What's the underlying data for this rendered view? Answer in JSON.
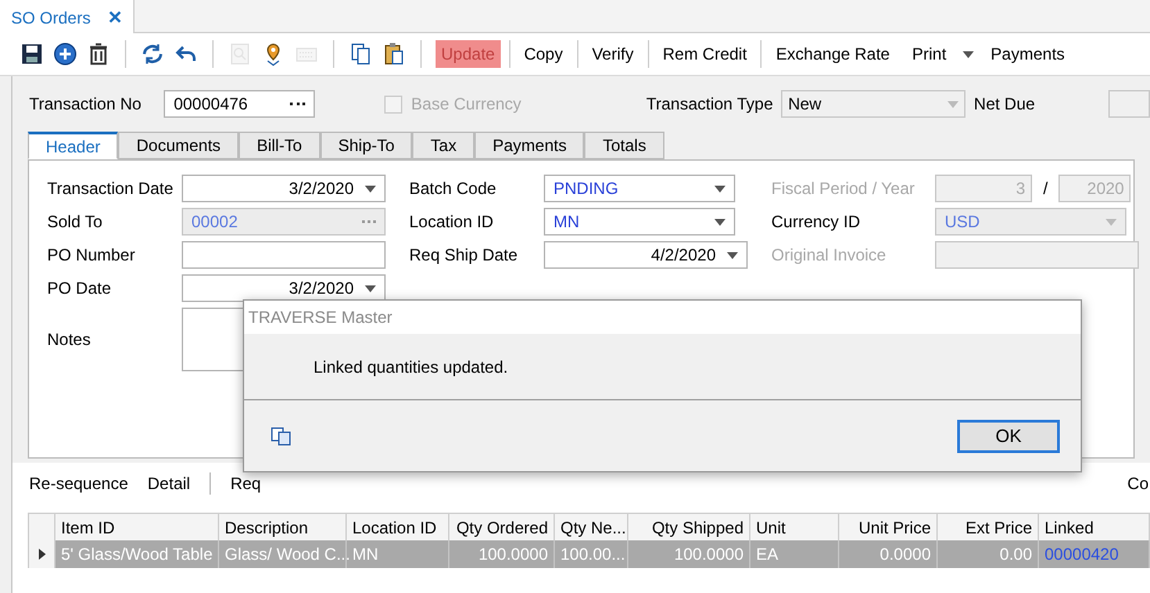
{
  "doc_tab": {
    "title": "SO Orders",
    "close": "✕",
    "selected": true
  },
  "toolbar": {
    "icons": [
      {
        "kind": "save",
        "disabled": false
      },
      {
        "kind": "add",
        "disabled": false
      },
      {
        "kind": "delete",
        "disabled": false
      },
      {
        "kind": "sep"
      },
      {
        "kind": "refresh",
        "disabled": false
      },
      {
        "kind": "undo",
        "disabled": false
      },
      {
        "kind": "sep"
      },
      {
        "kind": "search",
        "disabled": true
      },
      {
        "kind": "pin",
        "disabled": false
      },
      {
        "kind": "keyboard",
        "disabled": true
      },
      {
        "kind": "sep"
      },
      {
        "kind": "copy",
        "disabled": false
      },
      {
        "kind": "paste",
        "disabled": false
      },
      {
        "kind": "sep"
      }
    ],
    "buttons": [
      {
        "label": "Update",
        "disabled": true,
        "highlighted": true,
        "dropdown": false
      },
      {
        "label": "Copy",
        "disabled": false,
        "highlighted": false,
        "dropdown": false
      },
      {
        "label": "Verify",
        "disabled": false,
        "highlighted": false,
        "dropdown": false
      },
      {
        "label": "Rem Credit",
        "disabled": false,
        "highlighted": false,
        "dropdown": false
      },
      {
        "label": "Exchange Rate",
        "disabled": false,
        "highlighted": false,
        "dropdown": false
      },
      {
        "label": "Print",
        "disabled": false,
        "highlighted": false,
        "dropdown": true
      },
      {
        "label": "Payments",
        "disabled": false,
        "highlighted": false,
        "dropdown": false
      }
    ]
  },
  "header": {
    "transaction_no": {
      "label": "Transaction No",
      "value": "00000476"
    },
    "base_currency": {
      "label": "Base Currency",
      "checked": false,
      "disabled": true
    },
    "transaction_type": {
      "label": "Transaction Type",
      "value": "New",
      "disabled": true
    },
    "net_due": {
      "label": "Net Due"
    }
  },
  "tabs": [
    {
      "label": "Header",
      "selected": true
    },
    {
      "label": "Documents",
      "selected": false
    },
    {
      "label": "Bill-To",
      "selected": false
    },
    {
      "label": "Ship-To",
      "selected": false
    },
    {
      "label": "Tax",
      "selected": false
    },
    {
      "label": "Payments",
      "selected": false
    },
    {
      "label": "Totals",
      "selected": false
    }
  ],
  "columns": [
    [
      {
        "label": "Transaction Date",
        "kind": "date",
        "value": "3/2/2020",
        "disabled": false
      },
      {
        "label": "Sold To",
        "kind": "readonly_lookup",
        "value": "00002",
        "disabled": false
      },
      {
        "label": "PO Number",
        "kind": "text",
        "disabled": false
      },
      {
        "label": "PO Date",
        "kind": "date",
        "value": "3/2/2020",
        "disabled": false
      },
      {
        "label": "Notes",
        "kind": "notes",
        "disabled": false
      }
    ],
    [
      {
        "label": "Batch Code",
        "kind": "combo",
        "value": "PNDING",
        "disabled": false
      },
      {
        "label": "Location ID",
        "kind": "combo",
        "value": "MN",
        "disabled": false
      },
      {
        "label": "Req Ship Date",
        "kind": "date",
        "value": "4/2/2020",
        "disabled": false
      }
    ],
    [
      {
        "label": "Fiscal Period / Year",
        "kind": "pair",
        "values": [
          "3",
          "2020"
        ],
        "separator": "/",
        "disabled": true
      },
      {
        "label": "Currency ID",
        "kind": "readonly_combo",
        "value": "USD",
        "disabled": false
      },
      {
        "label": "Original Invoice",
        "kind": "text",
        "disabled": true
      }
    ]
  ],
  "dialog": {
    "title": "TRAVERSE Master",
    "message": "Linked quantities updated.",
    "button": "OK"
  },
  "grid_toolbar": [
    {
      "label": "Re-sequence"
    },
    {
      "label": "Detail"
    },
    {
      "label": "Req"
    },
    {
      "label": "Co"
    }
  ],
  "grid": {
    "columns": [
      "Item ID",
      "Description",
      "Location ID",
      "Qty Ordered",
      "Qty Ne...",
      "Qty Shipped",
      "Unit",
      "Unit Price",
      "Ext Price",
      "Linked"
    ],
    "rows": [
      {
        "selected": true,
        "cells": [
          "5' Glass/Wood Table",
          "Glass/ Wood C...",
          "MN",
          "100.0000",
          "100.00...",
          "100.0000",
          "EA",
          "0.0000",
          "0.00",
          "00000420"
        ]
      }
    ]
  }
}
